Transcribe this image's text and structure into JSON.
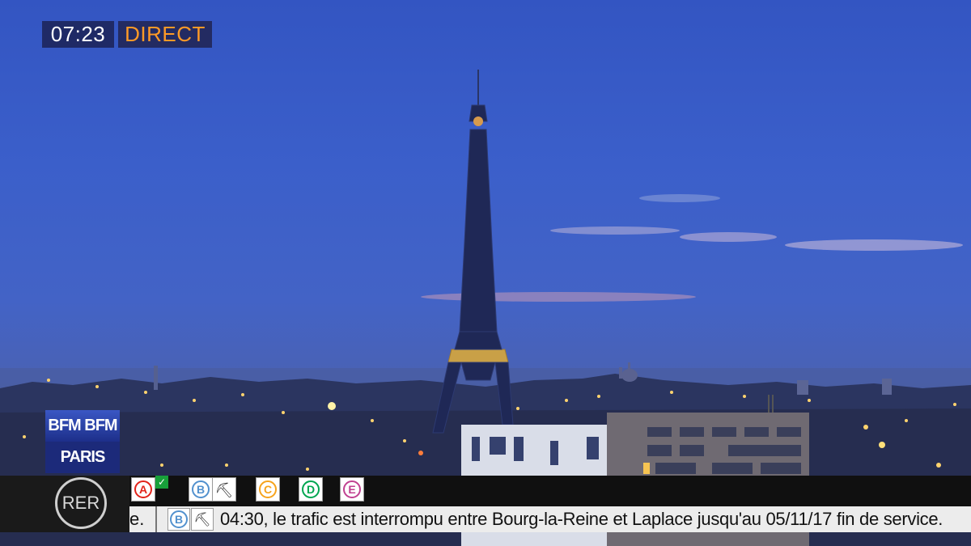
{
  "overlay": {
    "time": "07:23",
    "live_label": "DIRECT"
  },
  "logo": {
    "line1": "BFM BFM",
    "line2": "PARIS PARIS"
  },
  "rer": {
    "label": "RER",
    "lines": [
      {
        "letter": "A",
        "color": "#e2231a",
        "status_icon": "check-icon"
      },
      {
        "letter": "B",
        "color": "#5291ce",
        "status_icon": "roadworks-icon"
      },
      {
        "letter": "C",
        "color": "#f6a31c"
      },
      {
        "letter": "D",
        "color": "#00a650"
      },
      {
        "letter": "E",
        "color": "#c04191"
      }
    ]
  },
  "ticker": {
    "previous_fragment": "e.",
    "line_letter": "B",
    "message": "04:30, le trafic est interrompu entre Bourg-la-Reine et Laplace jusqu'au 05/11/17 fin de service."
  },
  "colors": {
    "sky": "#3b5fca",
    "live_text": "#ff9a26",
    "badge_bg": "#1f2a66"
  }
}
